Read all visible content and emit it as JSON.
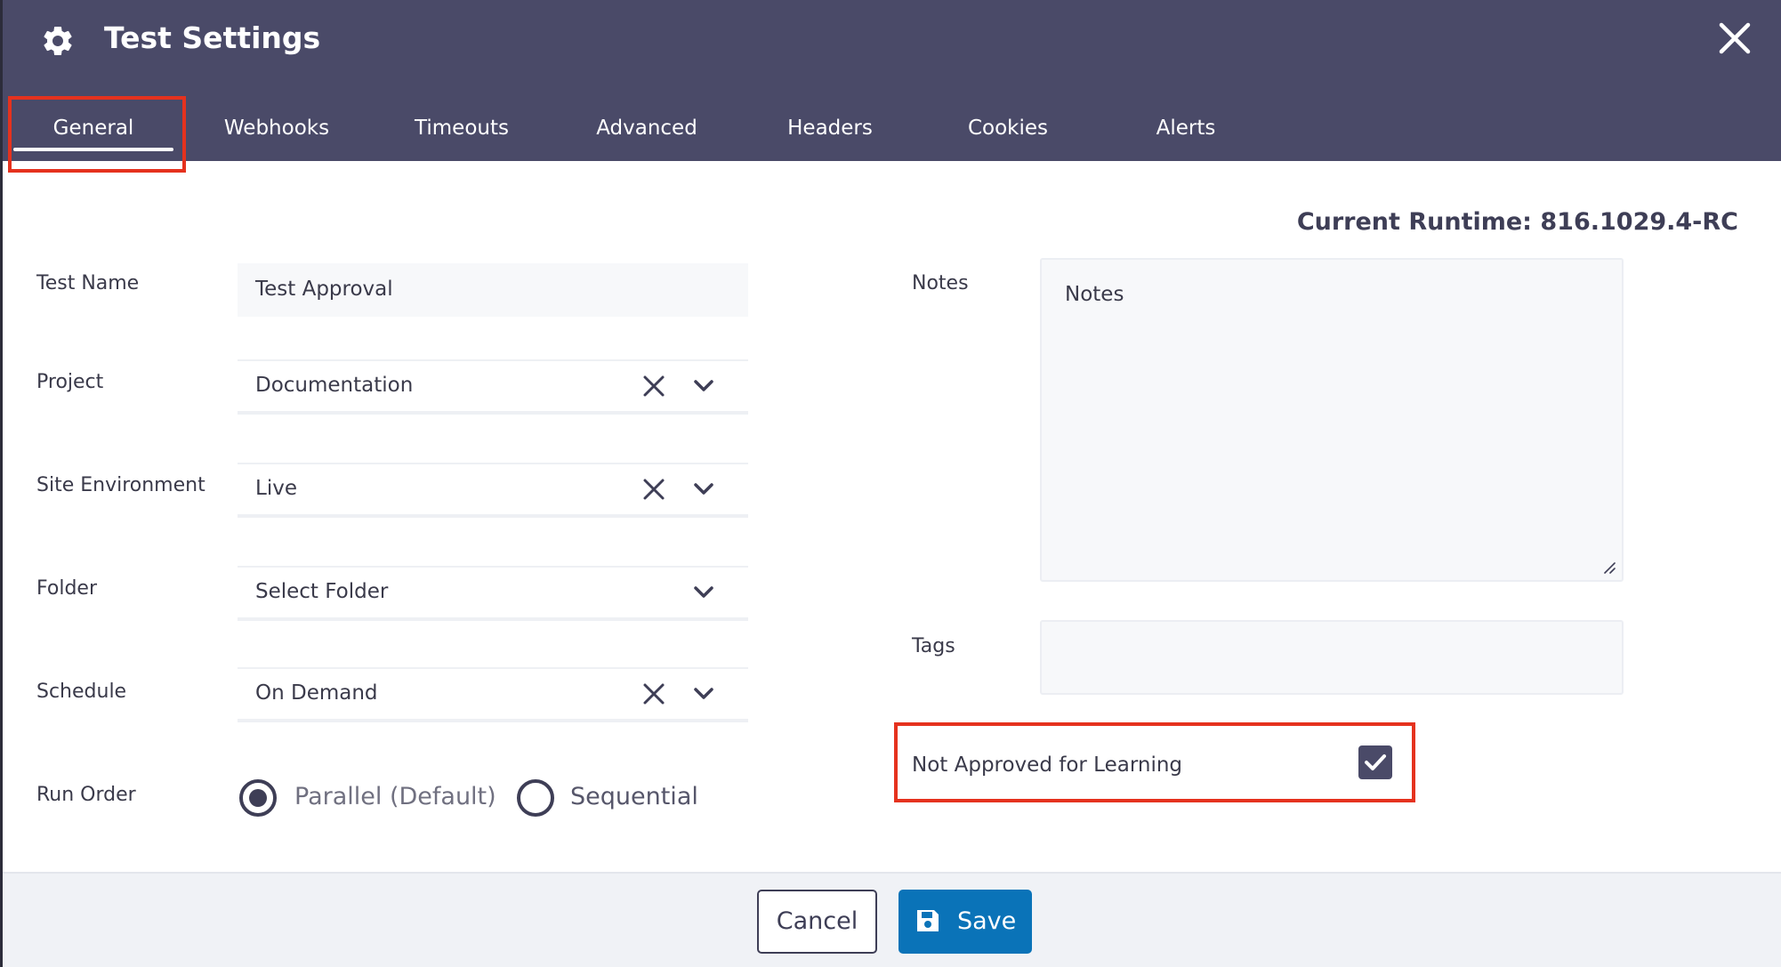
{
  "window": {
    "title": "Test Settings",
    "icons": {
      "settings": "gear-icon",
      "close": "close-icon"
    }
  },
  "tabs": [
    {
      "label": "General",
      "active": true
    },
    {
      "label": "Webhooks",
      "active": false
    },
    {
      "label": "Timeouts",
      "active": false
    },
    {
      "label": "Advanced",
      "active": false
    },
    {
      "label": "Headers",
      "active": false
    },
    {
      "label": "Cookies",
      "active": false
    },
    {
      "label": "Alerts",
      "active": false
    }
  ],
  "runtime": "Current Runtime: 816.1029.4-RC",
  "form": {
    "test_name": {
      "label": "Test Name",
      "value": "Test Approval"
    },
    "project": {
      "label": "Project",
      "value": "Documentation"
    },
    "site_environment": {
      "label": "Site Environment",
      "value": "Live"
    },
    "folder": {
      "label": "Folder",
      "value": "Select Folder"
    },
    "schedule": {
      "label": "Schedule",
      "value": "On Demand"
    },
    "run_order": {
      "label": "Run Order",
      "options": [
        "Parallel (Default)",
        "Sequential"
      ],
      "selected": "Parallel (Default)"
    },
    "notes": {
      "label": "Notes",
      "placeholder": "Notes"
    },
    "tags": {
      "label": "Tags",
      "value": ""
    },
    "not_approved": {
      "label": "Not Approved for Learning",
      "checked": true
    }
  },
  "footer": {
    "cancel_label": "Cancel",
    "save_label": "Save"
  },
  "colors": {
    "header": "#4a4a68",
    "accent": "#0a73b8",
    "highlight": "#e5321e"
  }
}
